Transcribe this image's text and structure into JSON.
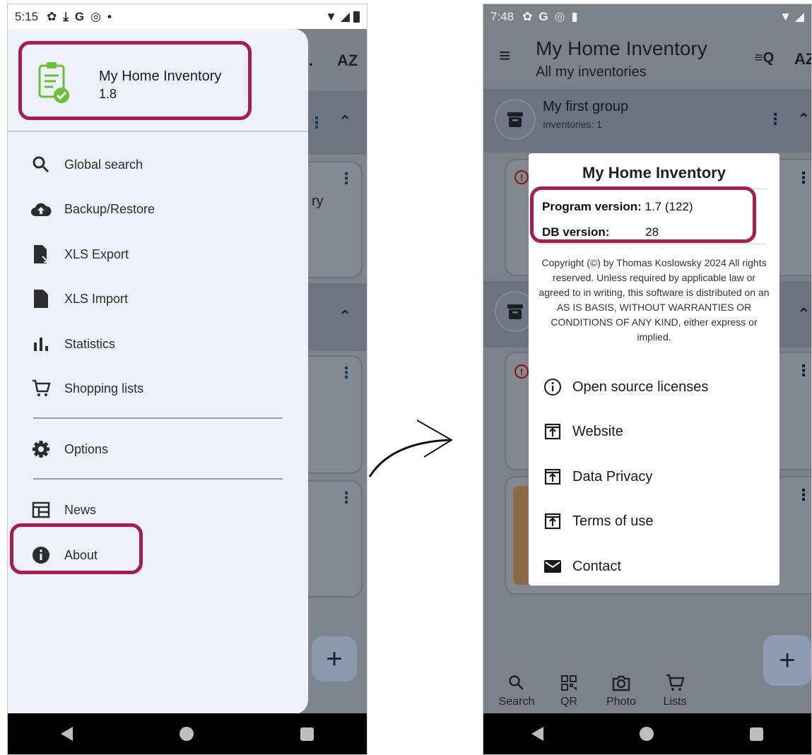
{
  "left_phone": {
    "status": {
      "time": "5:15",
      "icons": [
        "settings-icon",
        "download-icon",
        "google-icon",
        "sync-icon",
        "dot-icon"
      ]
    },
    "drawer": {
      "app_name": "My Home Inventory",
      "app_version": "1.8",
      "items": [
        {
          "label": "Global search",
          "icon": "search-icon"
        },
        {
          "label": "Backup/Restore",
          "icon": "cloud-upload-icon"
        },
        {
          "label": "XLS Export",
          "icon": "file-export-icon"
        },
        {
          "label": "XLS Import",
          "icon": "file-icon"
        },
        {
          "label": "Statistics",
          "icon": "bar-chart-icon"
        },
        {
          "label": "Shopping lists",
          "icon": "cart-icon"
        },
        {
          "label": "Options",
          "icon": "gear-icon"
        },
        {
          "label": "News",
          "icon": "news-icon"
        },
        {
          "label": "About",
          "icon": "info-icon"
        }
      ]
    },
    "background": {
      "sort_label": "AZ",
      "partial_text": "ry",
      "fab": "+"
    }
  },
  "right_phone": {
    "status": {
      "time": "7:48"
    },
    "toolbar": {
      "title": "My Home Inventory",
      "subtitle": "All my inventories",
      "sort_label": "AZ"
    },
    "group": {
      "name": "My first group",
      "count": "Inventories: 1"
    },
    "fab": "+",
    "bottom_nav": [
      {
        "label": "Search",
        "icon": "search-icon"
      },
      {
        "label": "QR",
        "icon": "qr-icon"
      },
      {
        "label": "Photo",
        "icon": "camera-icon"
      },
      {
        "label": "Lists",
        "icon": "cart-icon"
      }
    ],
    "about_dialog": {
      "title": "My Home Inventory",
      "program_version_label": "Program version:",
      "program_version": "1.7 (122)",
      "db_version_label": "DB version:",
      "db_version": "28",
      "copyright": "Copyright (©) by Thomas Koslowsky 2024 All rights reserved. Unless required by applicable law or agreed to in writing, this software is distributed on an AS IS BASIS, WITHOUT WARRANTIES OR CONDITIONS OF ANY KIND, either express or implied.",
      "items": [
        {
          "label": "Open source licenses",
          "icon": "info-outline-icon"
        },
        {
          "label": "Website",
          "icon": "open-external-icon"
        },
        {
          "label": "Data Privacy",
          "icon": "open-external-icon"
        },
        {
          "label": "Terms of use",
          "icon": "open-external-icon"
        },
        {
          "label": "Contact",
          "icon": "mail-icon"
        }
      ]
    }
  },
  "colors": {
    "highlight": "#a41e52",
    "drawer_bg": "#eef1f7",
    "logo_green": "#6bbf3a"
  }
}
